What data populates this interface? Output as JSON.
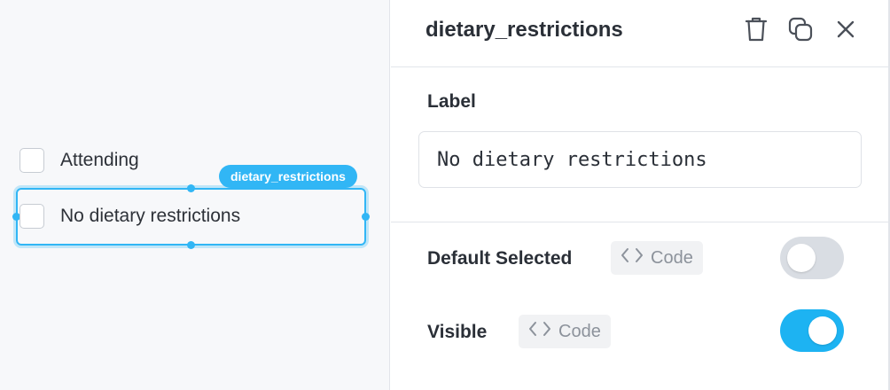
{
  "canvas": {
    "checkboxes": [
      {
        "label": "Attending",
        "checked": false
      },
      {
        "label": "No dietary restrictions",
        "checked": false,
        "selected": true
      }
    ],
    "selection_tag": "dietary_restrictions",
    "accent_color": "#31b6f5"
  },
  "inspector": {
    "title": "dietary_restrictions",
    "header_icons": [
      "trash-icon",
      "duplicate-icon",
      "close-icon"
    ],
    "label_section": {
      "title": "Label",
      "value": "No dietary restrictions"
    },
    "properties": [
      {
        "label": "Default Selected",
        "code_button": "Code",
        "toggle_on": false
      },
      {
        "label": "Visible",
        "code_button": "Code",
        "toggle_on": true
      }
    ],
    "toggle_on_color": "#1db3f2",
    "toggle_off_color": "#d9dde3"
  }
}
